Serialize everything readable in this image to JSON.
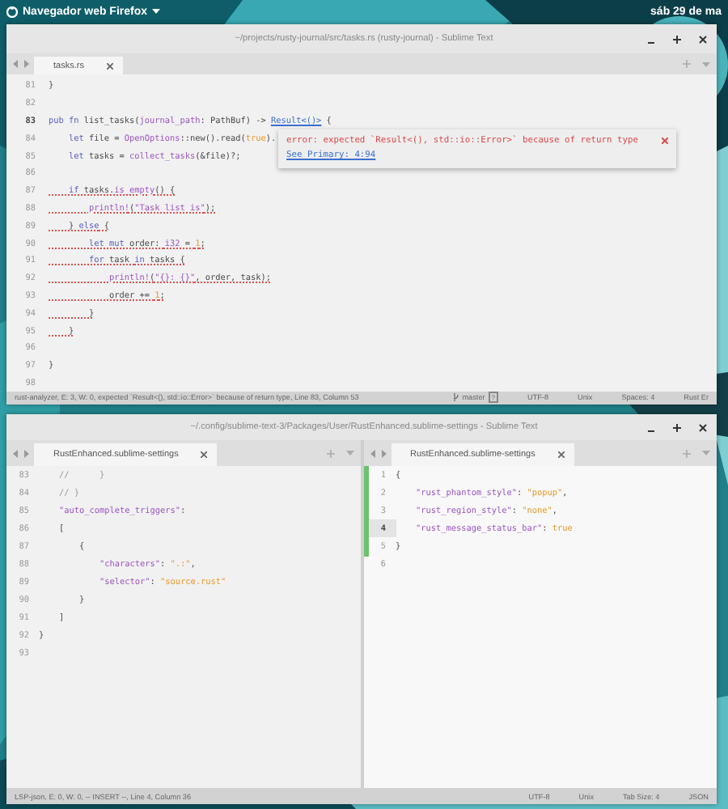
{
  "top_panel": {
    "app_menu": "Navegador web Firefox",
    "clock": "sáb 29 de ma"
  },
  "windows": [
    {
      "title": "~/projects/rusty-journal/src/tasks.rs (rusty-journal) - Sublime Text",
      "panes": [
        {
          "focused": false,
          "tabs": [
            {
              "label": "tasks.rs",
              "selected": true
            }
          ],
          "popup": {
            "message": "error: expected `Result<(), std::io::Error>` because of return type",
            "link": "See Primary: 4:94"
          },
          "lines": [
            {
              "n": "81",
              "current": false,
              "error": false,
              "code": [
                {
                  "kind": "plain",
                  "text": "}"
                }
              ]
            },
            {
              "n": "82",
              "current": false,
              "error": false
            },
            {
              "n": "83",
              "current": true,
              "error": false,
              "code": [
                {
                  "kind": "keyword",
                  "text": "pub fn"
                },
                {
                  "kind": "plain",
                  "text": " list_tasks("
                },
                {
                  "kind": "param",
                  "text": "journal_path"
                },
                {
                  "kind": "plain",
                  "text": ": PathBuf) -> "
                },
                {
                  "kind": "link",
                  "text": "Result<()>"
                },
                {
                  "kind": "plain",
                  "text": " {"
                }
              ]
            },
            {
              "n": "84",
              "current": false,
              "error": false,
              "code": [
                {
                  "kind": "keyword",
                  "text": "    let"
                },
                {
                  "kind": "plain",
                  "text": " file = "
                },
                {
                  "kind": "func",
                  "text": "OpenOptions"
                },
                {
                  "kind": "plain",
                  "text": "::new().read("
                },
                {
                  "kind": "number",
                  "text": "true"
                },
                {
                  "kind": "plain",
                  "text": ")."
                }
              ]
            },
            {
              "n": "85",
              "current": false,
              "error": false,
              "code": [
                {
                  "kind": "keyword",
                  "text": "    let"
                },
                {
                  "kind": "plain",
                  "text": " tasks = "
                },
                {
                  "kind": "func",
                  "text": "collect_tasks"
                },
                {
                  "kind": "plain",
                  "text": "(&file)?;"
                }
              ]
            },
            {
              "n": "86",
              "current": false,
              "error": false
            },
            {
              "n": "87",
              "current": false,
              "error": true,
              "code": [
                {
                  "kind": "keyword",
                  "text": "    if"
                },
                {
                  "kind": "plain",
                  "text": " tasks."
                },
                {
                  "kind": "func",
                  "text": "is_empty"
                },
                {
                  "kind": "plain",
                  "text": "() {"
                }
              ]
            },
            {
              "n": "88",
              "current": false,
              "error": true,
              "code": [
                {
                  "kind": "func",
                  "text": "        println!"
                },
                {
                  "kind": "plain",
                  "text": "("
                },
                {
                  "kind": "string",
                  "text": "\"Task list is\""
                },
                {
                  "kind": "plain",
                  "text": ");"
                }
              ]
            },
            {
              "n": "89",
              "current": false,
              "error": true,
              "code": [
                {
                  "kind": "plain",
                  "text": "    } "
                },
                {
                  "kind": "keyword",
                  "text": "else"
                },
                {
                  "kind": "plain",
                  "text": " {"
                }
              ]
            },
            {
              "n": "90",
              "current": false,
              "error": true,
              "code": [
                {
                  "kind": "keyword",
                  "text": "        let mut"
                },
                {
                  "kind": "plain",
                  "text": " order: "
                },
                {
                  "kind": "type",
                  "text": "i32"
                },
                {
                  "kind": "plain",
                  "text": " = "
                },
                {
                  "kind": "number",
                  "text": "1"
                },
                {
                  "kind": "plain",
                  "text": ";"
                }
              ]
            },
            {
              "n": "91",
              "current": false,
              "error": true,
              "code": [
                {
                  "kind": "keyword",
                  "text": "        for"
                },
                {
                  "kind": "plain",
                  "text": " task "
                },
                {
                  "kind": "keyword",
                  "text": "in"
                },
                {
                  "kind": "plain",
                  "text": " tasks {"
                }
              ]
            },
            {
              "n": "92",
              "current": false,
              "error": true,
              "code": [
                {
                  "kind": "func",
                  "text": "            println!"
                },
                {
                  "kind": "plain",
                  "text": "("
                },
                {
                  "kind": "string",
                  "text": "\"{}: {}\""
                },
                {
                  "kind": "plain",
                  "text": ", order, task);"
                }
              ]
            },
            {
              "n": "93",
              "current": false,
              "error": true,
              "code": [
                {
                  "kind": "plain",
                  "text": "            order += "
                },
                {
                  "kind": "number",
                  "text": "1"
                },
                {
                  "kind": "plain",
                  "text": ";"
                }
              ]
            },
            {
              "n": "94",
              "current": false,
              "error": true,
              "code": [
                {
                  "kind": "plain",
                  "text": "        }"
                }
              ]
            },
            {
              "n": "95",
              "current": false,
              "error": true,
              "code": [
                {
                  "kind": "plain",
                  "text": "    }"
                }
              ]
            },
            {
              "n": "96",
              "current": false,
              "error": false
            },
            {
              "n": "97",
              "current": false,
              "error": false,
              "code": [
                {
                  "kind": "plain",
                  "text": "}"
                }
              ]
            },
            {
              "n": "98",
              "current": false,
              "error": false
            }
          ]
        }
      ],
      "status_bar": {
        "message": "rust-analyzer, E: 3, W: 0, expected `Result<(), std::io::Error>` because of return type, Line 83, Column 53",
        "items": [
          {
            "kind": "branch",
            "text": "master",
            "badge": "?"
          },
          {
            "kind": "text",
            "text": "UTF-8"
          },
          {
            "kind": "text",
            "text": "Unix"
          },
          {
            "kind": "text",
            "text": "Spaces: 4"
          },
          {
            "kind": "text",
            "text": "Rust Er"
          }
        ]
      }
    },
    {
      "title": "~/.config/sublime-text-3/Packages/User/RustEnhanced.sublime-settings - Sublime Text",
      "panes": [
        {
          "focused": false,
          "tabs": [
            {
              "label": "RustEnhanced.sublime-settings",
              "selected": true
            }
          ],
          "lines": [
            {
              "n": "83",
              "current": false,
              "code": [
                {
                  "kind": "comment",
                  "text": "    //      }"
                }
              ]
            },
            {
              "n": "84",
              "current": false,
              "code": [
                {
                  "kind": "comment",
                  "text": "    // }"
                }
              ]
            },
            {
              "n": "85",
              "current": false,
              "code": [
                {
                  "kind": "key",
                  "text": "    \"auto_complete_triggers\""
                },
                {
                  "kind": "plain",
                  "text": ":"
                }
              ]
            },
            {
              "n": "86",
              "current": false,
              "code": [
                {
                  "kind": "plain",
                  "text": "    ["
                }
              ]
            },
            {
              "n": "87",
              "current": false,
              "code": [
                {
                  "kind": "plain",
                  "text": "        {"
                }
              ]
            },
            {
              "n": "88",
              "current": false,
              "code": [
                {
                  "kind": "key",
                  "text": "            \"characters\""
                },
                {
                  "kind": "plain",
                  "text": ": "
                },
                {
                  "kind": "string2",
                  "text": "\".:\""
                },
                {
                  "kind": "plain",
                  "text": ","
                }
              ]
            },
            {
              "n": "89",
              "current": false,
              "code": [
                {
                  "kind": "key",
                  "text": "            \"selector\""
                },
                {
                  "kind": "plain",
                  "text": ": "
                },
                {
                  "kind": "string2",
                  "text": "\"source.rust\""
                }
              ]
            },
            {
              "n": "90",
              "current": false,
              "code": [
                {
                  "kind": "plain",
                  "text": "        }"
                }
              ]
            },
            {
              "n": "91",
              "current": false,
              "code": [
                {
                  "kind": "plain",
                  "text": "    ]"
                }
              ]
            },
            {
              "n": "92",
              "current": false,
              "code": [
                {
                  "kind": "plain",
                  "text": "}"
                }
              ]
            },
            {
              "n": "93",
              "current": false
            }
          ]
        },
        {
          "focused": true,
          "tabs": [
            {
              "label": "RustEnhanced.sublime-settings",
              "selected": true
            }
          ],
          "lines": [
            {
              "n": "1",
              "current": false,
              "code": [
                {
                  "kind": "plain",
                  "text": "{"
                }
              ]
            },
            {
              "n": "2",
              "current": false,
              "code": [
                {
                  "kind": "key",
                  "text": "    \"rust_phantom_style\""
                },
                {
                  "kind": "plain",
                  "text": ": "
                },
                {
                  "kind": "string2",
                  "text": "\"popup\""
                },
                {
                  "kind": "plain",
                  "text": ","
                }
              ]
            },
            {
              "n": "3",
              "current": false,
              "code": [
                {
                  "kind": "key",
                  "text": "    \"rust_region_style\""
                },
                {
                  "kind": "plain",
                  "text": ": "
                },
                {
                  "kind": "string2",
                  "text": "\"none\""
                },
                {
                  "kind": "plain",
                  "text": ","
                }
              ]
            },
            {
              "n": "4",
              "current": true,
              "code": [
                {
                  "kind": "key",
                  "text": "    \"rust_message_status_bar\""
                },
                {
                  "kind": "plain",
                  "text": ": "
                },
                {
                  "kind": "number",
                  "text": "true"
                }
              ]
            },
            {
              "n": "5",
              "current": false,
              "code": [
                {
                  "kind": "plain",
                  "text": "}"
                }
              ]
            },
            {
              "n": "6",
              "current": false
            }
          ]
        }
      ],
      "status_bar": {
        "message": "LSP-json, E: 0, W: 0, -- INSERT --, Line 4, Column 36",
        "items": [
          {
            "kind": "text",
            "text": "UTF-8"
          },
          {
            "kind": "text",
            "text": "Unix"
          },
          {
            "kind": "text",
            "text": "Tab Size: 4"
          },
          {
            "kind": "text",
            "text": "JSON"
          }
        ]
      }
    }
  ]
}
